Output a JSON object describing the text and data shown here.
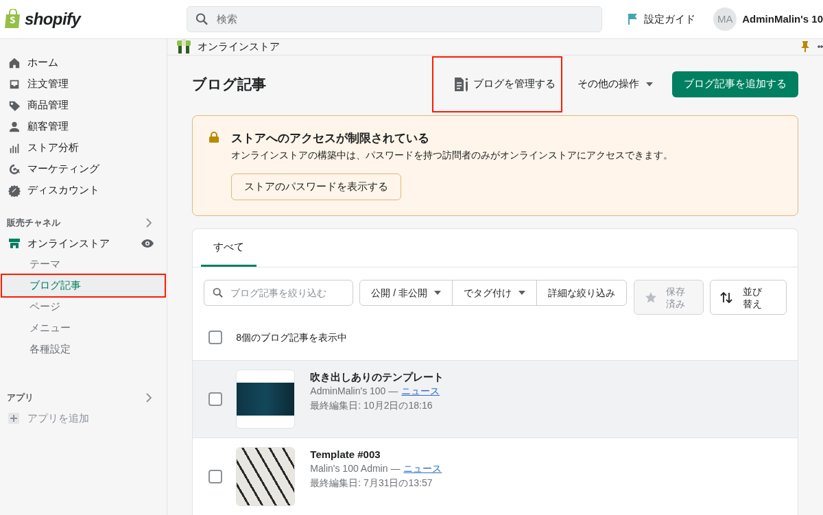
{
  "topbar": {
    "logo": "shopify",
    "search": {
      "placeholder": "検索"
    },
    "setup_guide": "設定ガイド",
    "avatar": "MA",
    "store_name": "AdminMalin's 10"
  },
  "sidebar": {
    "items": [
      {
        "label": "ホーム",
        "selected": false
      },
      {
        "label": "注文管理",
        "selected": false
      },
      {
        "label": "商品管理",
        "selected": false
      },
      {
        "label": "顧客管理",
        "selected": false
      },
      {
        "label": "ストア分析",
        "selected": false
      },
      {
        "label": "マーケティング",
        "selected": false
      },
      {
        "label": "ディスカウント",
        "selected": false
      }
    ],
    "channels_heading": "販売チャネル",
    "channel": "オンラインストア",
    "sub_items": [
      {
        "label": "テーマ",
        "selected": false,
        "highlighted": false
      },
      {
        "label": "ブログ記事",
        "selected": true,
        "highlighted": true
      },
      {
        "label": "ページ",
        "selected": false,
        "highlighted": false
      },
      {
        "label": "メニュー",
        "selected": false,
        "highlighted": false
      },
      {
        "label": "各種設定",
        "selected": false,
        "highlighted": false
      }
    ],
    "apps_heading": "アプリ",
    "add_app": "アプリを追加"
  },
  "channel_bar": {
    "title": "オンラインストア"
  },
  "page": {
    "title": "ブログ記事",
    "manage_blogs": {
      "label": "ブログを管理する",
      "highlighted": true
    },
    "more_actions": "その他の操作",
    "primary_action": "ブログ記事を追加する"
  },
  "banner": {
    "title": "ストアへのアクセスが制限されている",
    "text": "オンラインストアの構築中は、パスワードを持つ訪問者のみがオンラインストアにアクセスできます。",
    "button": "ストアのパスワードを表示する"
  },
  "list": {
    "tabs": [
      {
        "label": "すべて",
        "selected": true
      }
    ],
    "filter": {
      "placeholder": "ブログ記事を絞り込む"
    },
    "filters": [
      {
        "label": "公開 / 非公開",
        "dropdown": true
      },
      {
        "label": "でタグ付け",
        "dropdown": true
      },
      {
        "label": "詳細な絞り込み",
        "dropdown": false
      }
    ],
    "saved": {
      "label": "保存済み",
      "disabled": true
    },
    "sort": "並び替え",
    "select_all": {
      "checked": false
    },
    "count": "8個のブログ記事を表示中",
    "rows": [
      {
        "title": "吹き出しありのテンプレート",
        "author": "AdminMalin's 100 —",
        "blog": "ニュース",
        "edited": "最終編集日: 10月2日の18:16",
        "hovered": true,
        "checked": false
      },
      {
        "title": "Template #003",
        "author": "Malin's 100 Admin —",
        "blog": "ニュース",
        "edited": "最終編集日: 7月31日の13:57",
        "hovered": false,
        "checked": false
      }
    ]
  }
}
